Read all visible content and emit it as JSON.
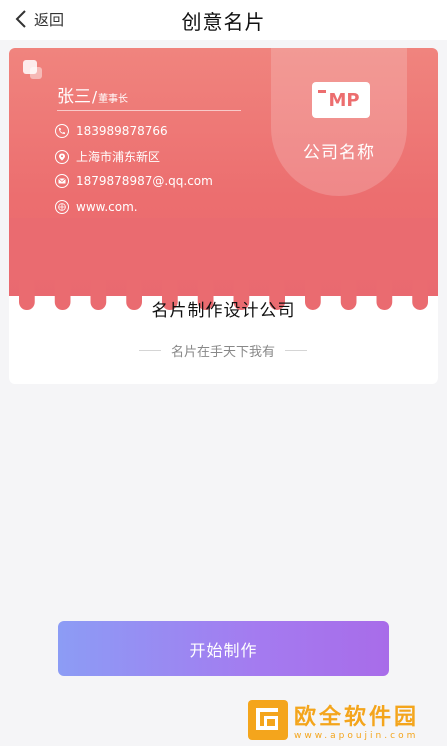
{
  "nav": {
    "back_label": "返回",
    "title": "创意名片"
  },
  "card": {
    "logo_text": "MP",
    "company_name": "公司名称",
    "person_name": "张三",
    "person_slash": "/",
    "person_role": "董事长",
    "phone": "183989878766",
    "address": "上海市浦东新区",
    "email": "1879878987@.qq.com",
    "website": "www.com.",
    "title": "名片制作设计公司",
    "slogan": "名片在手天下我有",
    "colors": {
      "card_top": "#ec6e6f",
      "logo_text": "#ec6e6f"
    }
  },
  "action": {
    "start_label": "开始制作",
    "gradient_from": "#8c9cf5",
    "gradient_to": "#a86ce9"
  },
  "watermark": {
    "main": "欧全软件园",
    "sub": "www.apoujin.com"
  }
}
